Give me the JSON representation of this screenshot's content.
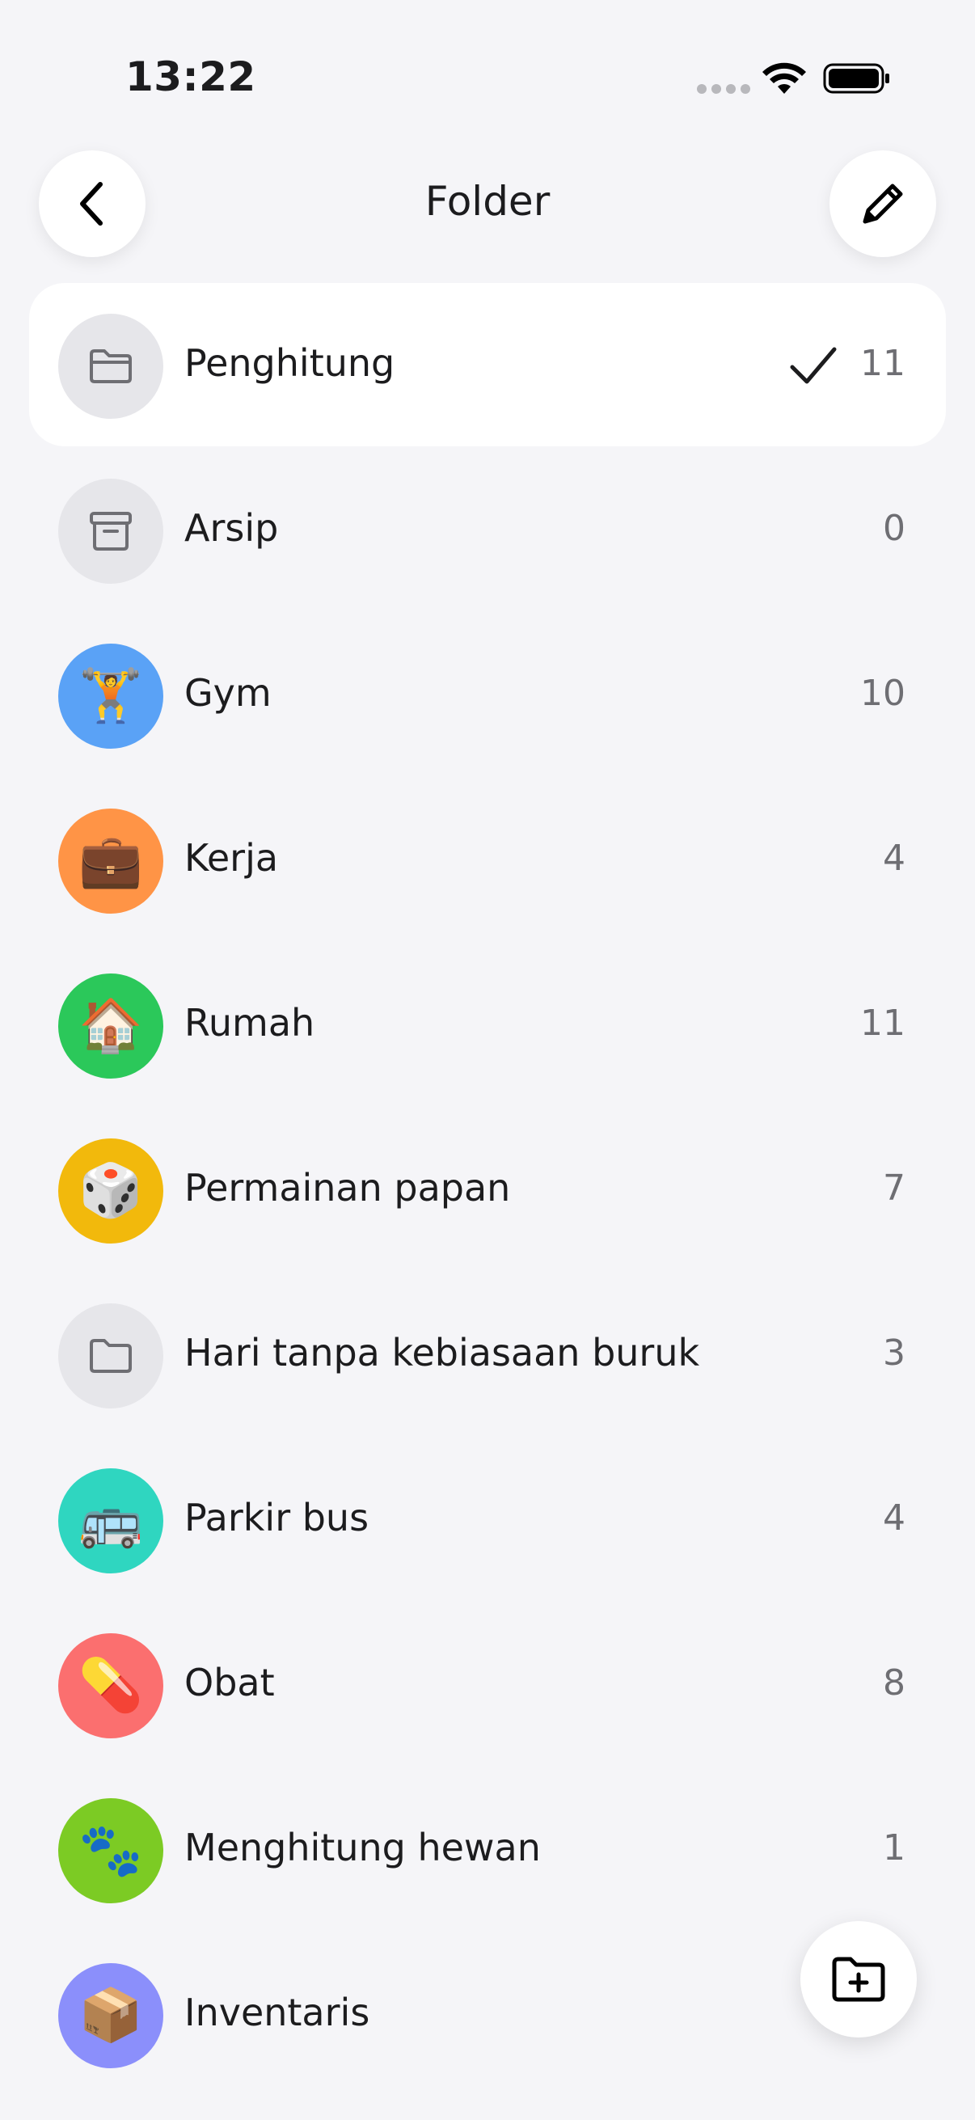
{
  "status_bar": {
    "time": "13:22"
  },
  "nav": {
    "title": "Folder"
  },
  "folders": [
    {
      "name": "Penghitung",
      "count": "11",
      "icon": "folder-icon",
      "emoji": "",
      "color": "#e6e6ea",
      "selected": true
    },
    {
      "name": "Arsip",
      "count": "0",
      "icon": "archive-icon",
      "emoji": "",
      "color": "#e6e6ea",
      "selected": false
    },
    {
      "name": "Gym",
      "count": "10",
      "icon": "weightlifter-emoji",
      "emoji": "🏋️",
      "color": "#5aa2f6",
      "selected": false
    },
    {
      "name": "Kerja",
      "count": "4",
      "icon": "briefcase-emoji",
      "emoji": "💼",
      "color": "#ff9446",
      "selected": false
    },
    {
      "name": "Rumah",
      "count": "11",
      "icon": "house-emoji",
      "emoji": "🏠",
      "color": "#2bc85a",
      "selected": false
    },
    {
      "name": "Permainan papan",
      "count": "7",
      "icon": "dice-emoji",
      "emoji": "🎲",
      "color": "#f2b90c",
      "selected": false
    },
    {
      "name": "Hari tanpa kebiasaan buruk",
      "count": "3",
      "icon": "folder-icon",
      "emoji": "",
      "color": "#e6e6ea",
      "selected": false
    },
    {
      "name": "Parkir bus",
      "count": "4",
      "icon": "bus-emoji",
      "emoji": "🚌",
      "color": "#2fd6c0",
      "selected": false
    },
    {
      "name": "Obat",
      "count": "8",
      "icon": "pill-emoji",
      "emoji": "💊",
      "color": "#fb6f6f",
      "selected": false
    },
    {
      "name": "Menghitung hewan",
      "count": "1",
      "icon": "paw-prints-emoji",
      "emoji": "🐾",
      "color": "#7ccb24",
      "selected": false
    },
    {
      "name": "Inventaris",
      "count": "",
      "icon": "package-emoji",
      "emoji": "📦",
      "color": "#8b8ffb",
      "selected": false
    }
  ],
  "fab": {
    "icon": "folder-plus-icon"
  }
}
